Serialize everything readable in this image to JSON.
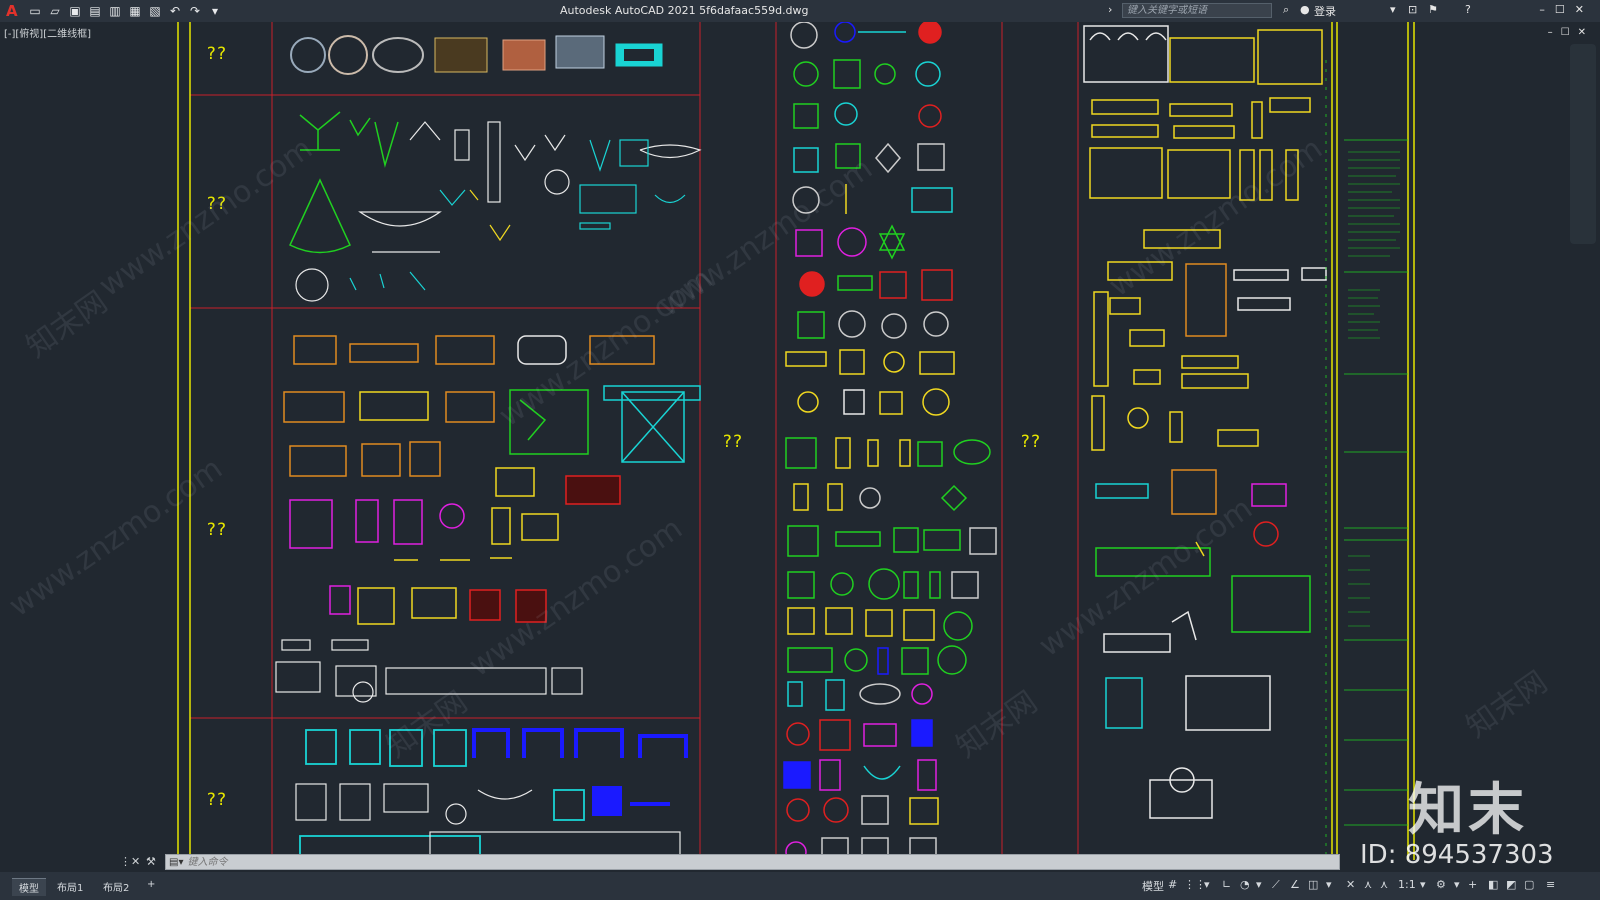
{
  "app": {
    "logo_letter": "A",
    "title": "Autodesk AutoCAD 2021    5f6dafaac559d.dwg",
    "search_placeholder": "键入关键字或短语",
    "login_label": "登录",
    "viewport_label": "[-][俯视][二维线框]"
  },
  "command": {
    "placeholder": "键入命令"
  },
  "layout_tabs": [
    {
      "label": "模型",
      "active": true
    },
    {
      "label": "布局1",
      "active": false
    },
    {
      "label": "布局2",
      "active": false
    },
    {
      "label": "+",
      "active": false
    }
  ],
  "status": {
    "model_label": "模型",
    "scale_label": "1:1"
  },
  "drawing": {
    "question_label": "??"
  },
  "watermark": {
    "logo_text": "知末",
    "id_text": "ID: 894537303",
    "url_text": "www.znzmo.com",
    "brand_text": "知末网"
  },
  "colors": {
    "canvas": "#212830",
    "border_yellow": "#e6e600",
    "grid_red": "#c8202a",
    "cyan": "#19d4d4",
    "green": "#20d020",
    "orange": "#e08a20",
    "red": "#e02020",
    "blue": "#1a1aff",
    "magenta": "#e020e0",
    "white": "#e8e8e8",
    "yellow": "#f0d820"
  }
}
